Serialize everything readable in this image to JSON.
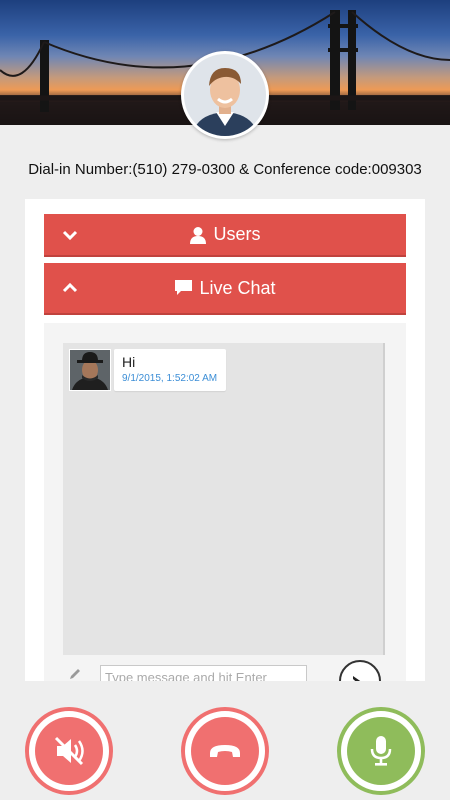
{
  "header": {
    "dial_info": "Dial-in Number:(510) 279-0300 & Conference code:009303"
  },
  "accordion": {
    "users_label": "Users",
    "chat_label": "Live Chat"
  },
  "chat": {
    "messages": [
      {
        "text": "Hi",
        "timestamp": "9/1/2015, 1:52:02 AM"
      }
    ],
    "input_placeholder": "Type message and hit Enter"
  },
  "controls": {
    "speaker": {
      "icon": "speaker-muted-icon",
      "color": "#f07070"
    },
    "hangup": {
      "icon": "phone-hangup-icon",
      "color": "#f07070"
    },
    "mic": {
      "icon": "microphone-icon",
      "color": "#8fbc5b"
    }
  },
  "colors": {
    "accent_red": "#e0514b",
    "timestamp_blue": "#3c8ed6"
  }
}
